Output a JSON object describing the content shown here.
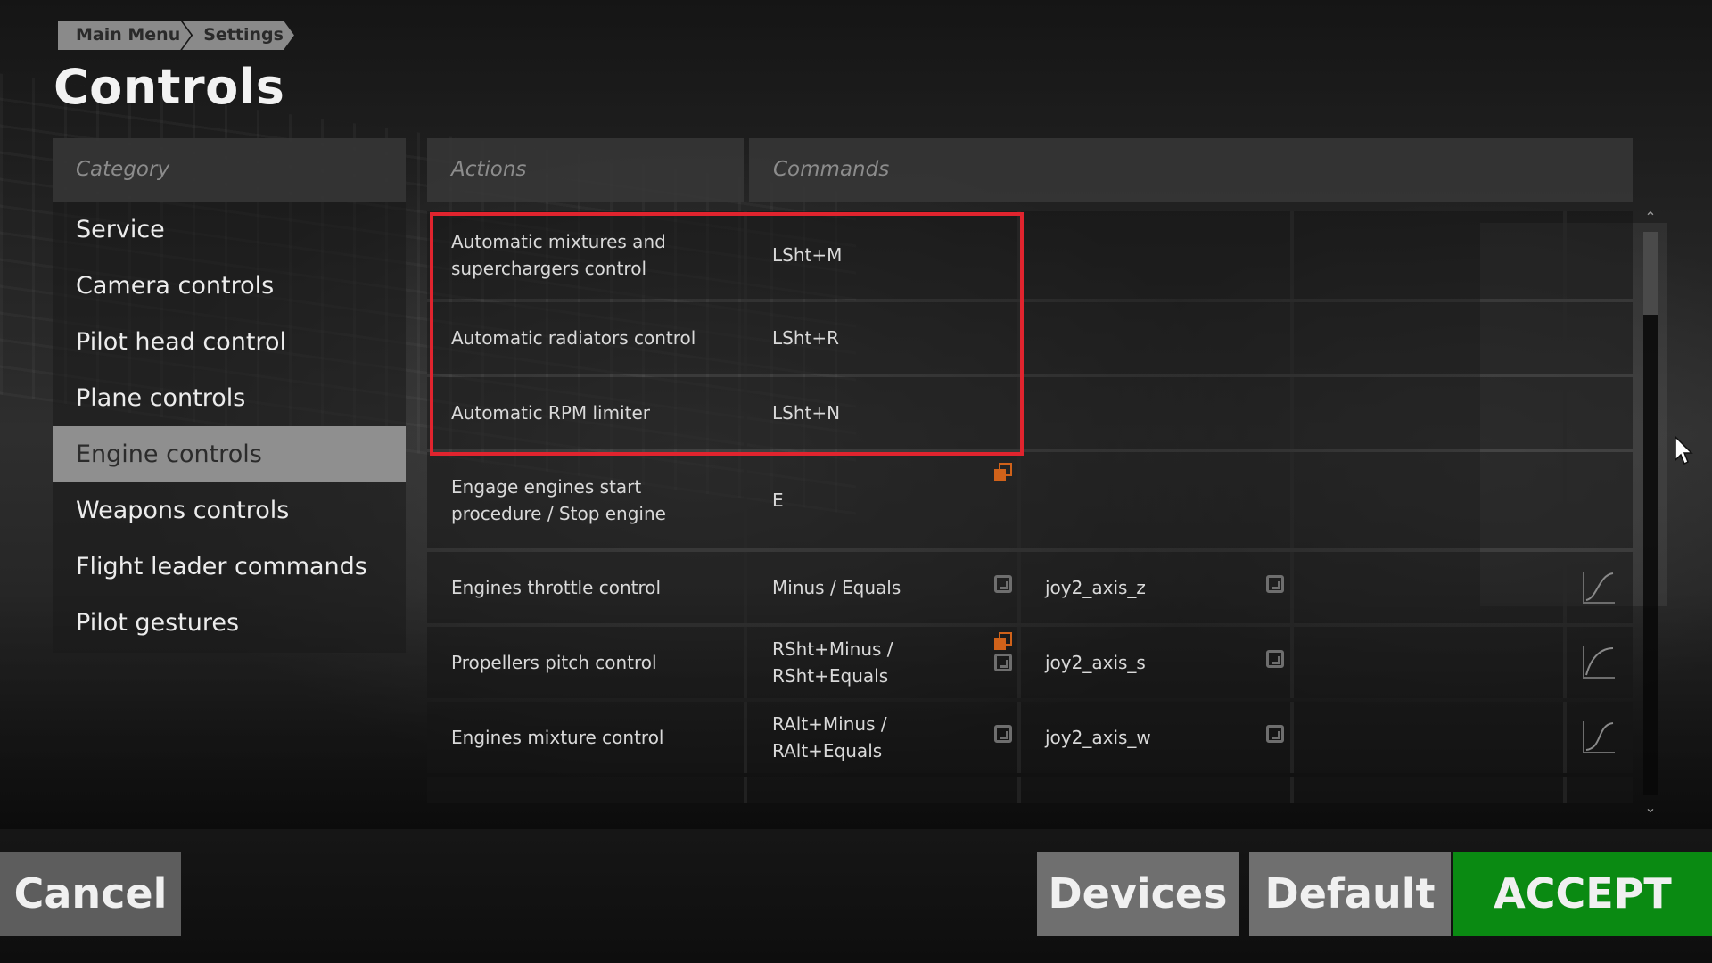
{
  "breadcrumb": [
    "Main Menu",
    "Settings"
  ],
  "page_title": "Controls",
  "category": {
    "header": "Category",
    "items": [
      {
        "label": "Service",
        "active": false
      },
      {
        "label": "Camera controls",
        "active": false
      },
      {
        "label": "Pilot head control",
        "active": false
      },
      {
        "label": "Plane controls",
        "active": false
      },
      {
        "label": "Engine controls",
        "active": true
      },
      {
        "label": "Weapons controls",
        "active": false
      },
      {
        "label": "Flight leader commands",
        "active": false
      },
      {
        "label": "Pilot gestures",
        "active": false
      }
    ]
  },
  "table": {
    "actions_header": "Actions",
    "commands_header": "Commands",
    "rows": [
      {
        "action": "Automatic mixtures and superchargers control",
        "command1": "LSht+M",
        "command2": ""
      },
      {
        "action": "Automatic radiators control",
        "command1": "LSht+R",
        "command2": ""
      },
      {
        "action": "Automatic RPM limiter",
        "command1": "LSht+N",
        "command2": ""
      },
      {
        "action": "Engage engines start procedure / Stop engine",
        "command1": "E",
        "command2": ""
      },
      {
        "action": "Engines throttle control",
        "command1": "Minus / Equals",
        "command2": "joy2_axis_z"
      },
      {
        "action": "Propellers pitch control",
        "command1": "RSht+Minus / RSht+Equals",
        "command2": "joy2_axis_s"
      },
      {
        "action": "Engines mixture control",
        "command1": "RAlt+Minus / RAlt+Equals",
        "command2": "joy2_axis_w"
      }
    ]
  },
  "buttons": {
    "cancel": "Cancel",
    "devices": "Devices",
    "default": "Default",
    "accept": "ACCEPT"
  },
  "colors": {
    "accept_green": "#0a8a12",
    "highlight_red": "#e0242e",
    "duplicate_orange": "#d0621a",
    "active_category": "#8f8f8f"
  },
  "icons": {
    "reset": "reset-binding-icon",
    "duplicate": "duplicate-binding-icon",
    "curve": "axis-curve-icon",
    "scroll_up": "chevron-up-icon",
    "scroll_down": "chevron-down-icon",
    "cursor": "mouse-cursor-icon"
  }
}
